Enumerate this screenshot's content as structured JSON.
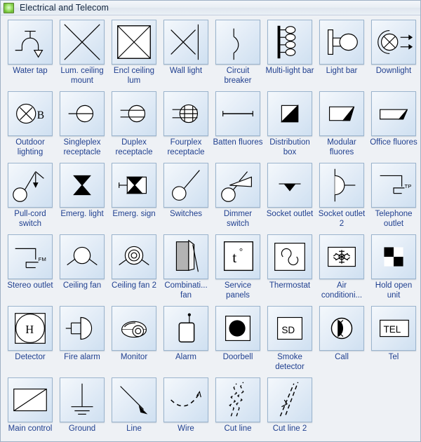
{
  "window": {
    "title": "Electrical and Telecom",
    "icon": "green-stencil-icon",
    "accent_color": "#1f3f8f",
    "tile_border_color": "#9bb4cd",
    "background_color": "#eef1f5"
  },
  "stencil": {
    "columns": 8,
    "items": [
      {
        "label": "Water tap",
        "icon": "water-tap-symbol"
      },
      {
        "label": "Lum. ceiling mount",
        "icon": "luminaire-ceiling-mount-symbol"
      },
      {
        "label": "Encl ceiling lum",
        "icon": "enclosed-ceiling-luminaire-symbol"
      },
      {
        "label": "Wall light",
        "icon": "wall-light-symbol"
      },
      {
        "label": "Circuit breaker",
        "icon": "circuit-breaker-symbol"
      },
      {
        "label": "Multi-light bar",
        "icon": "multi-light-bar-symbol"
      },
      {
        "label": "Light bar",
        "icon": "light-bar-symbol"
      },
      {
        "label": "Downlight",
        "icon": "downlight-symbol"
      },
      {
        "label": "Outdoor lighting",
        "icon": "outdoor-lighting-symbol"
      },
      {
        "label": "Singleplex receptacle",
        "icon": "singleplex-receptacle-symbol"
      },
      {
        "label": "Duplex receptacle",
        "icon": "duplex-receptacle-symbol"
      },
      {
        "label": "Fourplex receptacle",
        "icon": "fourplex-receptacle-symbol"
      },
      {
        "label": "Batten fluores",
        "icon": "batten-fluorescent-symbol"
      },
      {
        "label": "Distribution box",
        "icon": "distribution-box-symbol"
      },
      {
        "label": "Modular fluores",
        "icon": "modular-fluorescent-symbol"
      },
      {
        "label": "Office fluores",
        "icon": "office-fluorescent-symbol"
      },
      {
        "label": "Pull-cord switch",
        "icon": "pull-cord-switch-symbol"
      },
      {
        "label": "Emerg. light",
        "icon": "emergency-light-symbol"
      },
      {
        "label": "Emerg. sign",
        "icon": "emergency-sign-symbol"
      },
      {
        "label": "Switches",
        "icon": "switches-symbol"
      },
      {
        "label": "Dimmer switch",
        "icon": "dimmer-switch-symbol"
      },
      {
        "label": "Socket outlet",
        "icon": "socket-outlet-symbol"
      },
      {
        "label": "Socket outlet 2",
        "icon": "socket-outlet-2-symbol"
      },
      {
        "label": "Telephone outlet",
        "icon": "telephone-outlet-symbol"
      },
      {
        "label": "Stereo outlet",
        "icon": "stereo-outlet-symbol"
      },
      {
        "label": "Ceiling fan",
        "icon": "ceiling-fan-symbol"
      },
      {
        "label": "Ceiling fan 2",
        "icon": "ceiling-fan-2-symbol"
      },
      {
        "label": "Combinati... fan",
        "icon": "combination-fan-symbol"
      },
      {
        "label": "Service panels",
        "icon": "service-panels-symbol"
      },
      {
        "label": "Thermostat",
        "icon": "thermostat-symbol"
      },
      {
        "label": "Air conditioni...",
        "icon": "air-conditioning-symbol"
      },
      {
        "label": "Hold open unit",
        "icon": "hold-open-unit-symbol"
      },
      {
        "label": "Detector",
        "icon": "detector-symbol"
      },
      {
        "label": "Fire alarm",
        "icon": "fire-alarm-symbol"
      },
      {
        "label": "Monitor",
        "icon": "monitor-camera-symbol"
      },
      {
        "label": "Alarm",
        "icon": "alarm-symbol"
      },
      {
        "label": "Doorbell",
        "icon": "doorbell-symbol"
      },
      {
        "label": "Smoke detector",
        "icon": "smoke-detector-symbol"
      },
      {
        "label": "Call",
        "icon": "call-symbol"
      },
      {
        "label": "Tel",
        "icon": "tel-symbol"
      },
      {
        "label": "Main control",
        "icon": "main-control-symbol"
      },
      {
        "label": "Ground",
        "icon": "ground-symbol"
      },
      {
        "label": "Line",
        "icon": "line-symbol"
      },
      {
        "label": "Wire",
        "icon": "wire-symbol"
      },
      {
        "label": "Cut line",
        "icon": "cut-line-symbol"
      },
      {
        "label": "Cut line 2",
        "icon": "cut-line-2-symbol"
      }
    ],
    "symbol_text_labels": {
      "outdoor_lighting": "B",
      "service_panels": "t",
      "service_panels_degree": "°",
      "telephone_outlet": "TP",
      "stereo_outlet": "FM",
      "detector": "H",
      "smoke_detector": "SD",
      "tel": "TEL"
    }
  }
}
